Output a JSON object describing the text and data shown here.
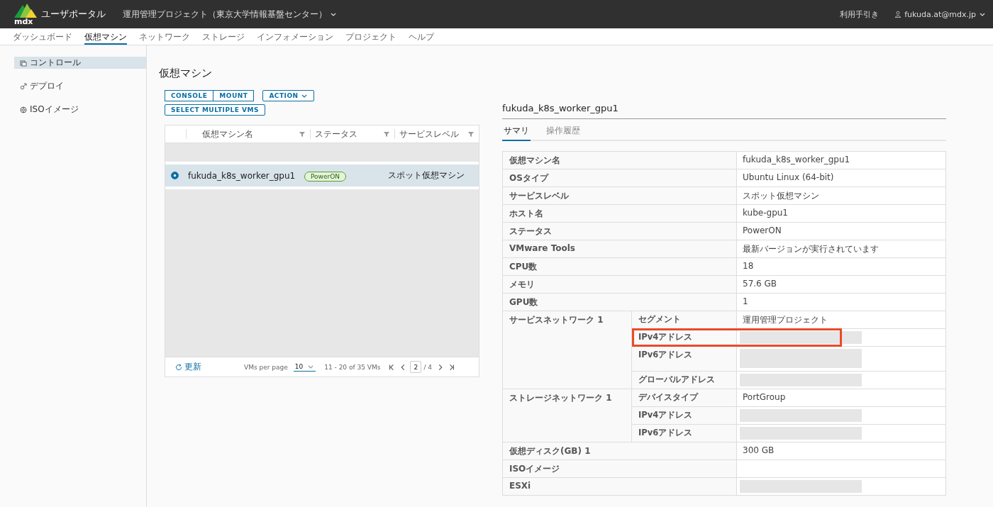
{
  "header": {
    "brand": "ユーザポータル",
    "logo_text": "mdx",
    "project": "運用管理プロジェクト（東京大学情報基盤センター）",
    "help_link": "利用手引き",
    "user": "fukuda.at@mdx.jp"
  },
  "nav": [
    {
      "label": "ダッシュボード",
      "selected": false
    },
    {
      "label": "仮想マシン",
      "selected": true
    },
    {
      "label": "ネットワーク",
      "selected": false
    },
    {
      "label": "ストレージ",
      "selected": false
    },
    {
      "label": "インフォメーション",
      "selected": false
    },
    {
      "label": "プロジェクト",
      "selected": false
    },
    {
      "label": "ヘルプ",
      "selected": false
    }
  ],
  "sidebar": {
    "items": [
      {
        "label": "コントロール",
        "kind": "control",
        "selected": true
      },
      {
        "label": "デプロイ",
        "kind": "deploy",
        "selected": false
      },
      {
        "label": "ISOイメージ",
        "kind": "iso",
        "selected": false
      }
    ]
  },
  "page_title": "仮想マシン",
  "toolbar": {
    "button_group": [
      "CONSOLE",
      "MOUNT"
    ],
    "action_button": "ACTION",
    "select_button": "SELECT MULTIPLE VMS"
  },
  "vm_table": {
    "columns": [
      "仮想マシン名",
      "ステータス",
      "サービスレベル"
    ],
    "rows": [
      {
        "name": "fukuda_k8s_worker_gpu1",
        "status": "PowerON",
        "service_level": "スポット仮想マシン",
        "selected": true
      }
    ],
    "footer": {
      "refresh": "更新",
      "per_page_label": "VMs per page",
      "per_page": "10",
      "range": "11 - 20 of 35 VMs",
      "page": "2",
      "page_total": "/ 4"
    }
  },
  "details": {
    "title": "fukuda_k8s_worker_gpu1",
    "tabs": [
      {
        "label": "サマリ",
        "selected": true
      },
      {
        "label": "操作履歴",
        "selected": false
      }
    ],
    "rows": [
      {
        "kind": "field",
        "label": "仮想マシン名",
        "value": "fukuda_k8s_worker_gpu1",
        "redacted": false
      },
      {
        "kind": "field",
        "label": "OSタイプ",
        "value": "Ubuntu Linux (64-bit)",
        "redacted": false
      },
      {
        "kind": "field",
        "label": "サービスレベル",
        "value": "スポット仮想マシン",
        "redacted": false
      },
      {
        "kind": "field",
        "label": "ホスト名",
        "value": "kube-gpu1",
        "redacted": false
      },
      {
        "kind": "field",
        "label": "ステータス",
        "value": "PowerON",
        "redacted": false
      },
      {
        "kind": "field",
        "label": "VMware Tools",
        "value": "最新バージョンが実行されています",
        "redacted": false
      },
      {
        "kind": "field",
        "label": "CPU数",
        "value": "18",
        "redacted": false
      },
      {
        "kind": "field",
        "label": "メモリ",
        "value": "57.6 GB",
        "redacted": false
      },
      {
        "kind": "field",
        "label": "GPU数",
        "value": "1",
        "redacted": false
      },
      {
        "kind": "group",
        "label": "サービスネットワーク 1",
        "children": [
          {
            "label": "セグメント",
            "value": "運用管理プロジェクト",
            "redacted": false,
            "highlighted": false
          },
          {
            "label": "IPv4アドレス",
            "redacted": true,
            "highlighted": true
          },
          {
            "label": "IPv6アドレス",
            "redacted": true,
            "highlighted": false
          },
          {
            "label": "グローバルアドレス",
            "redacted": true,
            "highlighted": false
          }
        ]
      },
      {
        "kind": "group",
        "label": "ストレージネットワーク 1",
        "children": [
          {
            "label": "デバイスタイプ",
            "value": "PortGroup",
            "redacted": false,
            "highlighted": false
          },
          {
            "label": "IPv4アドレス",
            "redacted": true,
            "highlighted": false
          },
          {
            "label": "IPv6アドレス",
            "redacted": true,
            "highlighted": false
          }
        ]
      },
      {
        "kind": "field",
        "label": "仮想ディスク(GB) 1",
        "value": "300 GB",
        "redacted": false
      },
      {
        "kind": "field",
        "label": "ISOイメージ",
        "redacted": false
      },
      {
        "kind": "field",
        "label": "ESXi",
        "redacted": true
      }
    ]
  }
}
